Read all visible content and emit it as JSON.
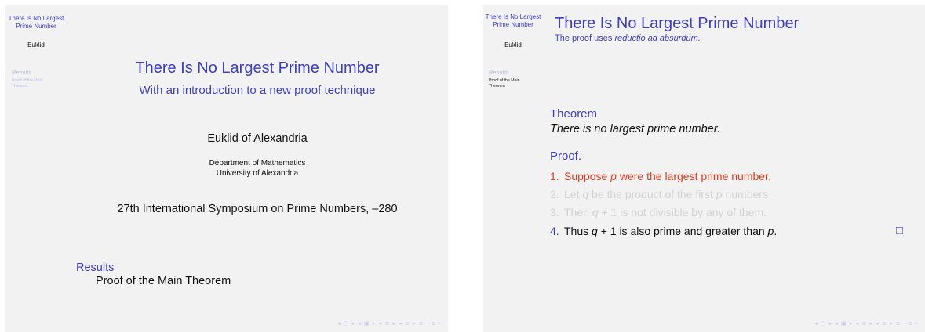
{
  "slide1": {
    "sidebar": {
      "title": "There Is No Largest Prime Number",
      "author": "Euklid",
      "section": "Results",
      "subsection": "Proof of the Main Theorem"
    },
    "title": "There Is No Largest Prime Number",
    "subtitle": "With an introduction to a new proof technique",
    "author": "Euklid of Alexandria",
    "institute_line1": "Department of Mathematics",
    "institute_line2": "University of Alexandria",
    "date": "27th International Symposium on Prime Numbers, –280",
    "toc_section": "Results",
    "toc_subsection": "Proof of the Main Theorem"
  },
  "slide2": {
    "sidebar": {
      "title": "There Is No Largest Prime Number",
      "author": "Euklid",
      "section": "Results",
      "subsection": "Proof of the Main Theorem"
    },
    "frame_title": "There Is No Largest Prime Number",
    "frame_subtitle_prefix": "The proof uses ",
    "frame_subtitle_emph": "reductio ad absurdum.",
    "theorem_label": "Theorem",
    "theorem_text": "There is no largest prime number.",
    "proof_label": "Proof.",
    "steps": [
      {
        "num": "1.",
        "pre": "Suppose ",
        "var": "p",
        "post": " were the largest prime number."
      },
      {
        "num": "2.",
        "pre": "Let ",
        "var": "q",
        "mid": " be the product of the first ",
        "var2": "p",
        "post": " numbers."
      },
      {
        "num": "3.",
        "pre": "Then ",
        "var": "q",
        "post": " + 1 is not divisible by any of them."
      },
      {
        "num": "4.",
        "pre": "Thus ",
        "var": "q",
        "mid": " + 1 is also prime and greater than ",
        "var2": "p",
        "post": "."
      }
    ],
    "qed_symbol": "□"
  },
  "navigation_symbols": "◂ □ ▸ ◂ ▣ ▸ ◂ ≡ ▸ ◂ ≡ ▸ ≡ ∽ɑ∼",
  "colors": {
    "structure_blue": "#3f3fbf",
    "alert_red": "#e0381f",
    "faded_text": "#d2d2d2",
    "slide_bg": "#f2f2f2"
  }
}
